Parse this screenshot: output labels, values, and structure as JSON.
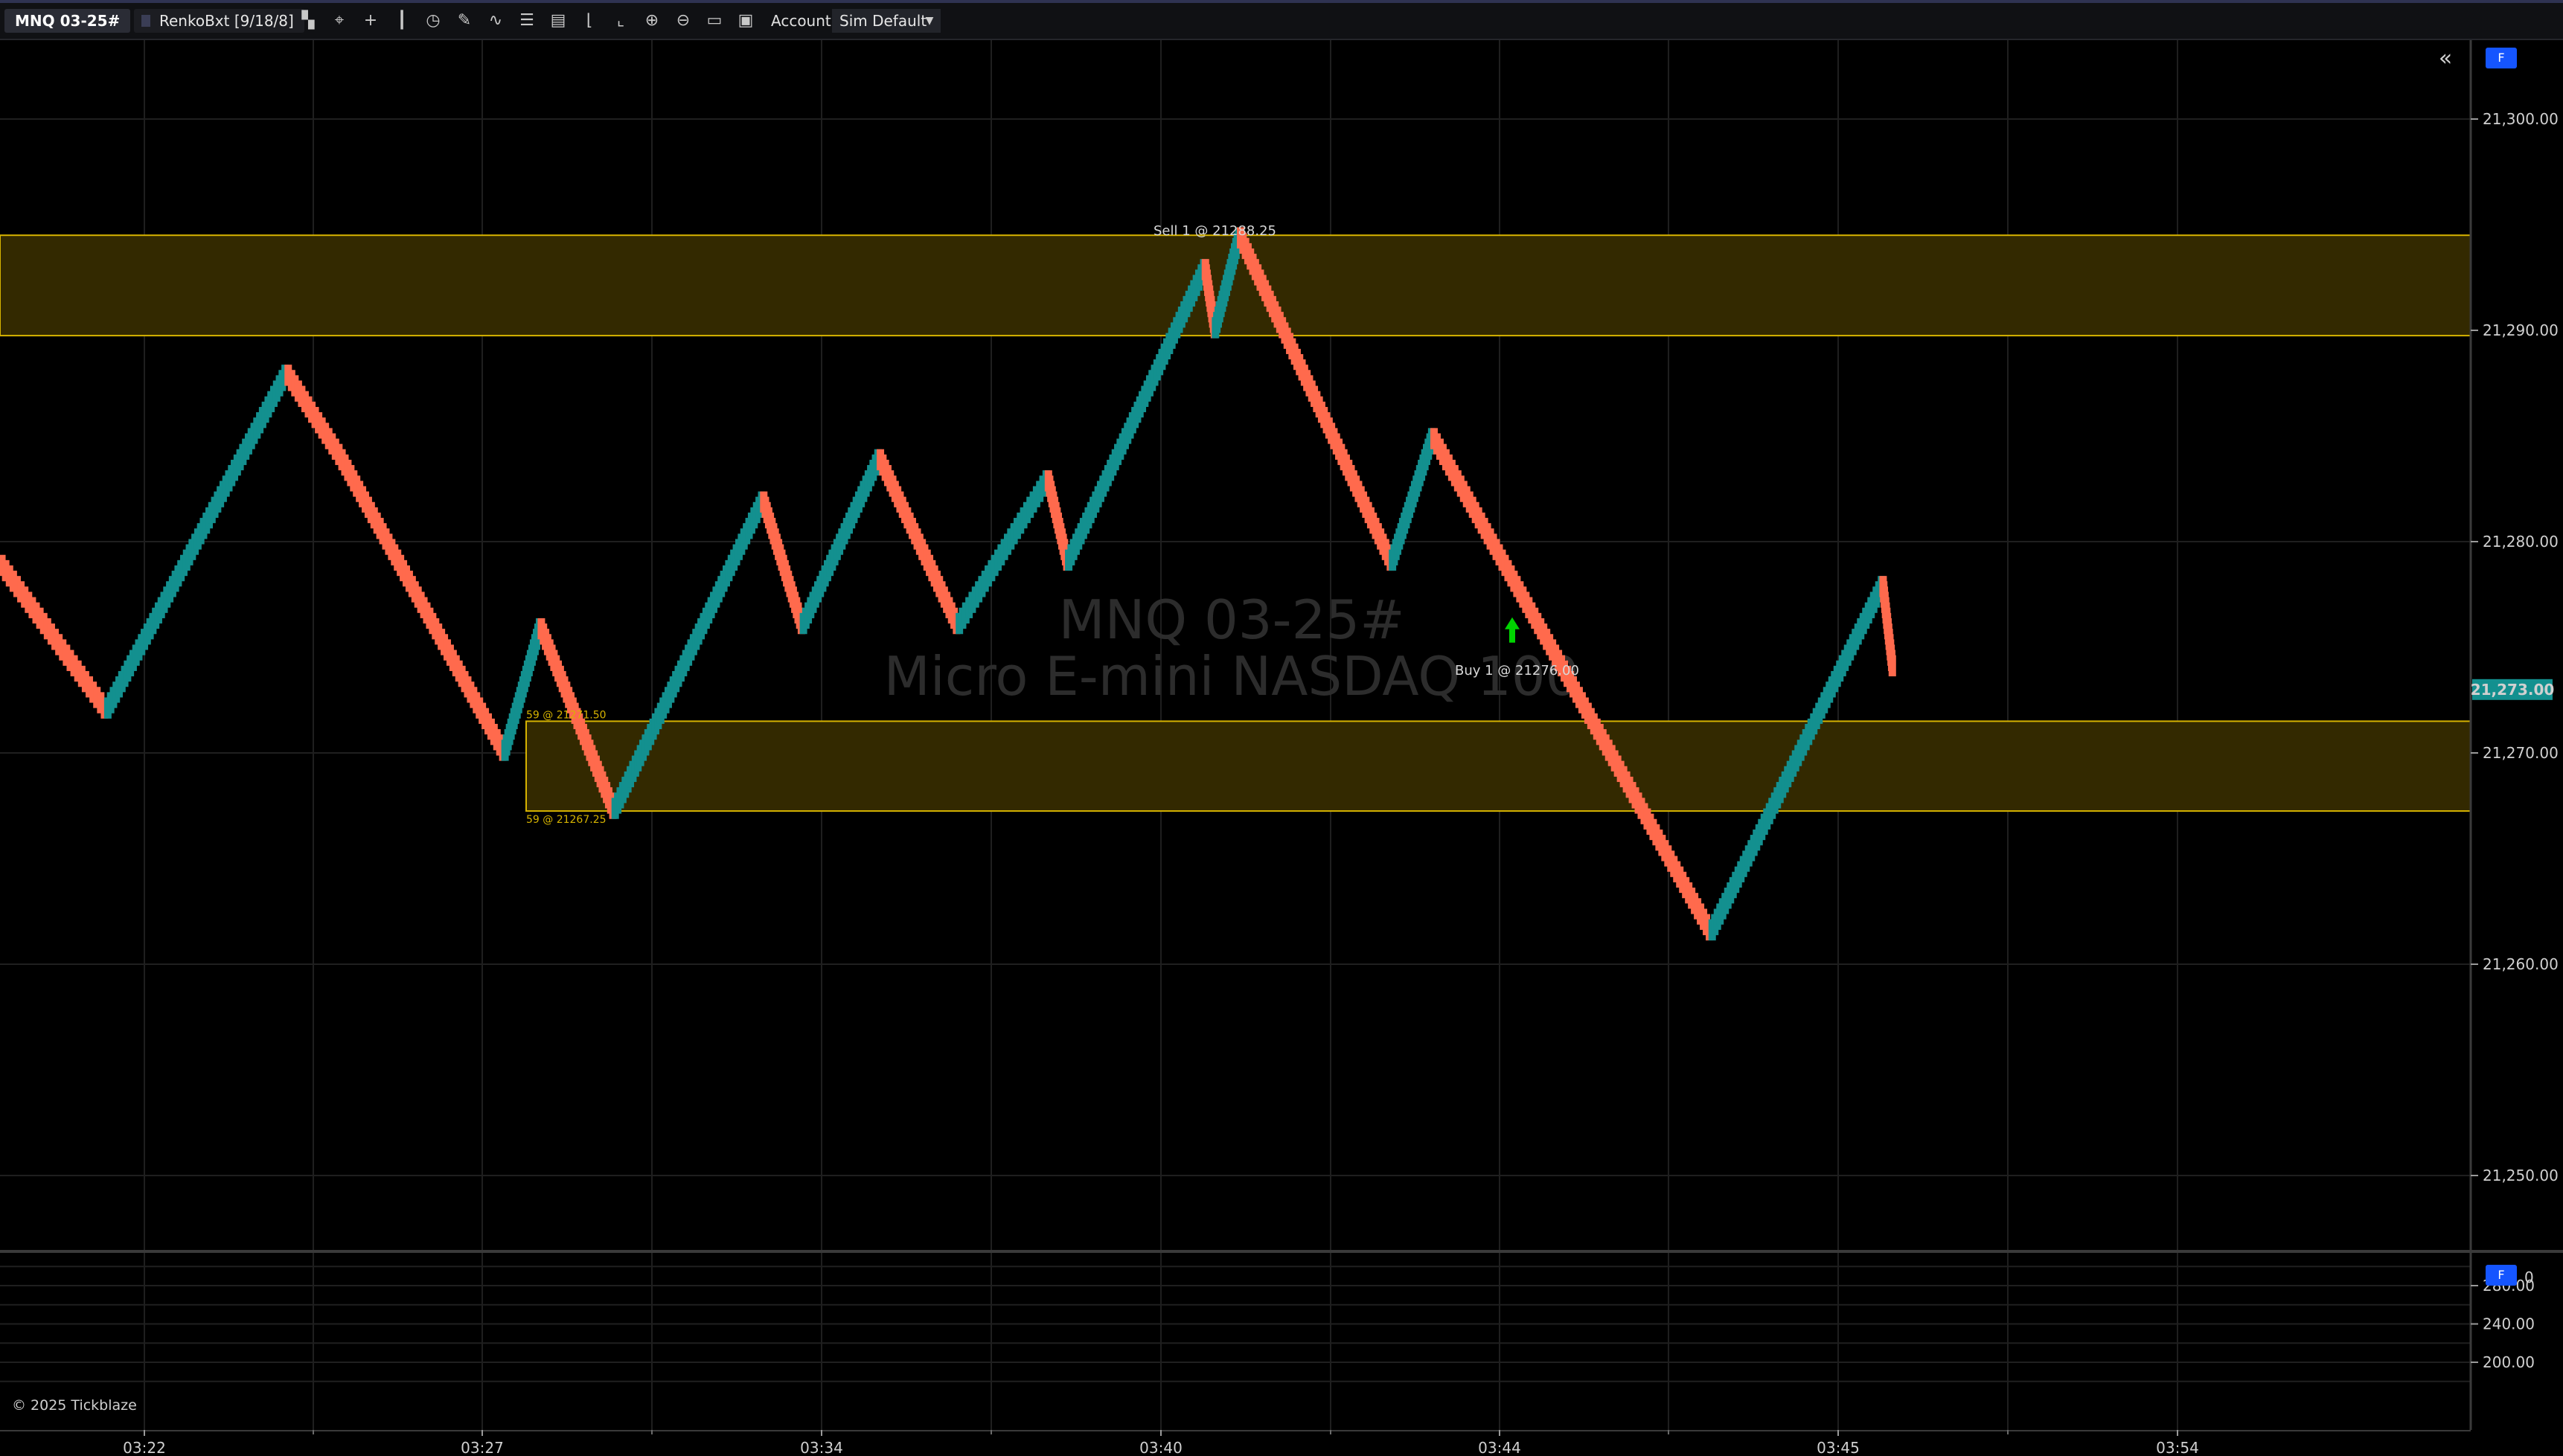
{
  "toolbar": {
    "symbol": "MNQ 03-25#",
    "period": "RenkoBxt [9/18/8]",
    "account_label": "Account:",
    "account_value": "Sim Default",
    "icons": [
      "panel-icon",
      "crosshair-box-icon",
      "crosshair-icon",
      "candlestick-icon",
      "clock-icon",
      "pencil-icon",
      "trend-icon",
      "list-icon",
      "template-icon",
      "draw-line-icon",
      "draw-tool-icon",
      "zoom-in-icon",
      "zoom-out-icon",
      "folder-icon",
      "save-icon"
    ]
  },
  "watermark": {
    "line1": "MNQ 03-25#",
    "line2": "Micro E-mini NASDAQ 100"
  },
  "price_axis": {
    "labels": [
      "21,300.00",
      "21,290.00",
      "21,280.00",
      "21,270.00",
      "21,260.00",
      "21,250.00"
    ],
    "values": [
      21300,
      21290,
      21280,
      21270,
      21260,
      21250
    ],
    "current_price": "21,273.00",
    "current_value": 21273,
    "current_color": "#13908f"
  },
  "sub_axis": {
    "labels": [
      "280.00",
      "240.00",
      "200.00"
    ],
    "values": [
      280,
      240,
      200
    ],
    "ylim": [
      175,
      320
    ],
    "partial_label": "0"
  },
  "time_axis": {
    "labels": [
      "03:22",
      "03:27",
      "03:34",
      "03:40",
      "03:44",
      "03:45",
      "03:54"
    ]
  },
  "zones": [
    {
      "top": 21294.5,
      "bottom": 21289.75,
      "label": ""
    },
    {
      "top": 21271.5,
      "bottom": 21267.25,
      "label_top": "59 @ 21271.50",
      "label_bottom": "59 @ 21267.25"
    }
  ],
  "trades": [
    {
      "text": "Sell 1 @ 21288.25"
    },
    {
      "text": "Buy 1 @ 21276.00"
    }
  ],
  "collapse_icon": "double-chevron-left-icon",
  "badge_main": "F",
  "badge_sub": "F",
  "copyright": "© 2025 Tickblaze",
  "colors": {
    "up": "#13908f",
    "down": "#ff6a4d",
    "zone_fill": "#332900",
    "zone_stroke": "#d6b300"
  },
  "chart_data": {
    "type": "line",
    "series": [
      {
        "x": [
          0,
          65,
          175,
          208,
          308,
          330,
          375,
          466,
          490,
          537,
          585,
          640,
          652,
          736,
          742,
          757,
          850,
          875,
          1045,
          1150,
          1156
        ],
        "values": [
          21279,
          21272,
          21288,
          21284,
          21270,
          21276,
          21267.25,
          21282,
          21276,
          21284,
          21276,
          21283,
          21279,
          21293,
          21290,
          21294.5,
          21279,
          21285,
          21261.5,
          21278,
          21274
        ]
      }
    ],
    "ylim": [
      21245,
      21305
    ]
  }
}
